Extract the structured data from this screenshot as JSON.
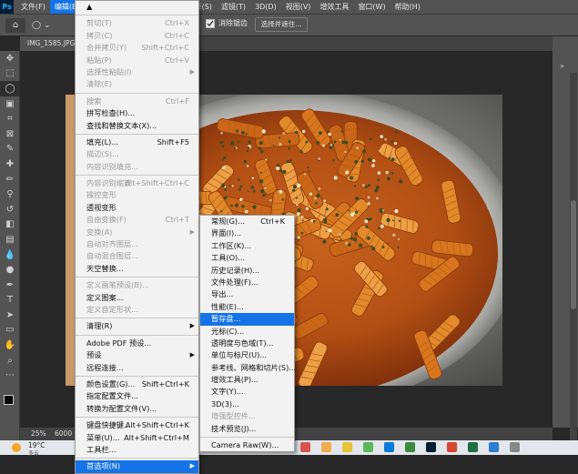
{
  "menubar": {
    "logo": "Ps",
    "items": [
      "文件(F)",
      "编辑(E)",
      "图像(I)",
      "图层(L)",
      "文字(Y)",
      "选择(S)",
      "滤镜(T)",
      "3D(D)",
      "视图(V)",
      "增效工具",
      "窗口(W)",
      "帮助(H)"
    ]
  },
  "optionsbar": {
    "antialias_label": "消除锯齿",
    "select_subject_label": "选择并遮住..."
  },
  "doc_tab": {
    "title": "IMG_1585.JPG"
  },
  "status": {
    "zoom": "25%",
    "info": "6000"
  },
  "taskbar": {
    "weather": "19°C",
    "weather_sub": "多云"
  },
  "edit_menu": {
    "items": [
      {
        "type": "item",
        "label": "▲",
        "shortcut": "",
        "disabled": false,
        "submenu": false
      },
      {
        "type": "sep"
      },
      {
        "type": "item",
        "label": "剪切(T)",
        "shortcut": "Ctrl+X",
        "disabled": true,
        "submenu": false
      },
      {
        "type": "item",
        "label": "拷贝(C)",
        "shortcut": "Ctrl+C",
        "disabled": true,
        "submenu": false
      },
      {
        "type": "item",
        "label": "合并拷贝(Y)",
        "shortcut": "Shift+Ctrl+C",
        "disabled": true,
        "submenu": false
      },
      {
        "type": "item",
        "label": "粘贴(P)",
        "shortcut": "Ctrl+V",
        "disabled": true,
        "submenu": false
      },
      {
        "type": "item",
        "label": "选择性粘贴(I)",
        "shortcut": "",
        "disabled": true,
        "submenu": true
      },
      {
        "type": "item",
        "label": "清除(E)",
        "shortcut": "",
        "disabled": true,
        "submenu": false
      },
      {
        "type": "sep"
      },
      {
        "type": "item",
        "label": "搜索",
        "shortcut": "Ctrl+F",
        "disabled": true,
        "submenu": false
      },
      {
        "type": "item",
        "label": "拼写检查(H)...",
        "shortcut": "",
        "disabled": false,
        "submenu": false
      },
      {
        "type": "item",
        "label": "查找和替换文本(X)...",
        "shortcut": "",
        "disabled": false,
        "submenu": false
      },
      {
        "type": "sep"
      },
      {
        "type": "item",
        "label": "填充(L)...",
        "shortcut": "Shift+F5",
        "disabled": false,
        "submenu": false
      },
      {
        "type": "item",
        "label": "描边(S)...",
        "shortcut": "",
        "disabled": true,
        "submenu": false
      },
      {
        "type": "item",
        "label": "内容识别填充...",
        "shortcut": "",
        "disabled": true,
        "submenu": false
      },
      {
        "type": "sep"
      },
      {
        "type": "item",
        "label": "内容识别缩放",
        "shortcut": "Alt+Shift+Ctrl+C",
        "disabled": true,
        "submenu": false
      },
      {
        "type": "item",
        "label": "操控变形",
        "shortcut": "",
        "disabled": true,
        "submenu": false
      },
      {
        "type": "item",
        "label": "透视变形",
        "shortcut": "",
        "disabled": false,
        "submenu": false
      },
      {
        "type": "item",
        "label": "自由变换(F)",
        "shortcut": "Ctrl+T",
        "disabled": true,
        "submenu": false
      },
      {
        "type": "item",
        "label": "变换(A)",
        "shortcut": "",
        "disabled": true,
        "submenu": true
      },
      {
        "type": "item",
        "label": "自动对齐图层...",
        "shortcut": "",
        "disabled": true,
        "submenu": false
      },
      {
        "type": "item",
        "label": "自动混合图层...",
        "shortcut": "",
        "disabled": true,
        "submenu": false
      },
      {
        "type": "item",
        "label": "天空替换...",
        "shortcut": "",
        "disabled": false,
        "submenu": false
      },
      {
        "type": "sep"
      },
      {
        "type": "item",
        "label": "定义画笔预设(B)...",
        "shortcut": "",
        "disabled": true,
        "submenu": false
      },
      {
        "type": "item",
        "label": "定义图案...",
        "shortcut": "",
        "disabled": false,
        "submenu": false
      },
      {
        "type": "item",
        "label": "定义自定形状...",
        "shortcut": "",
        "disabled": true,
        "submenu": false
      },
      {
        "type": "sep"
      },
      {
        "type": "item",
        "label": "清理(R)",
        "shortcut": "",
        "disabled": false,
        "submenu": true
      },
      {
        "type": "sep"
      },
      {
        "type": "item",
        "label": "Adobe PDF 预设...",
        "shortcut": "",
        "disabled": false,
        "submenu": false
      },
      {
        "type": "item",
        "label": "预设",
        "shortcut": "",
        "disabled": false,
        "submenu": true
      },
      {
        "type": "item",
        "label": "远程连接...",
        "shortcut": "",
        "disabled": false,
        "submenu": false
      },
      {
        "type": "sep"
      },
      {
        "type": "item",
        "label": "颜色设置(G)...",
        "shortcut": "Shift+Ctrl+K",
        "disabled": false,
        "submenu": false
      },
      {
        "type": "item",
        "label": "指定配置文件...",
        "shortcut": "",
        "disabled": false,
        "submenu": false
      },
      {
        "type": "item",
        "label": "转换为配置文件(V)...",
        "shortcut": "",
        "disabled": false,
        "submenu": false
      },
      {
        "type": "sep"
      },
      {
        "type": "item",
        "label": "键盘快捷键...",
        "shortcut": "Alt+Shift+Ctrl+K",
        "disabled": false,
        "submenu": false
      },
      {
        "type": "item",
        "label": "菜单(U)...",
        "shortcut": "Alt+Shift+Ctrl+M",
        "disabled": false,
        "submenu": false
      },
      {
        "type": "item",
        "label": "工具栏...",
        "shortcut": "",
        "disabled": false,
        "submenu": false
      },
      {
        "type": "sep"
      },
      {
        "type": "item",
        "label": "首选项(N)",
        "shortcut": "",
        "disabled": false,
        "submenu": true,
        "highlight": true
      }
    ]
  },
  "pref_menu": {
    "items": [
      {
        "type": "item",
        "label": "常规(G)...",
        "shortcut": "Ctrl+K",
        "disabled": false
      },
      {
        "type": "item",
        "label": "界面(I)...",
        "shortcut": "",
        "disabled": false
      },
      {
        "type": "item",
        "label": "工作区(K)...",
        "shortcut": "",
        "disabled": false
      },
      {
        "type": "item",
        "label": "工具(O)...",
        "shortcut": "",
        "disabled": false
      },
      {
        "type": "item",
        "label": "历史记录(H)...",
        "shortcut": "",
        "disabled": false
      },
      {
        "type": "item",
        "label": "文件处理(F)...",
        "shortcut": "",
        "disabled": false
      },
      {
        "type": "item",
        "label": "导出...",
        "shortcut": "",
        "disabled": false
      },
      {
        "type": "item",
        "label": "性能(E)...",
        "shortcut": "",
        "disabled": false
      },
      {
        "type": "item",
        "label": "暂存盘...",
        "shortcut": "",
        "disabled": false,
        "highlight": true
      },
      {
        "type": "item",
        "label": "光标(C)...",
        "shortcut": "",
        "disabled": false
      },
      {
        "type": "item",
        "label": "透明度与色域(T)...",
        "shortcut": "",
        "disabled": false
      },
      {
        "type": "item",
        "label": "单位与标尺(U)...",
        "shortcut": "",
        "disabled": false
      },
      {
        "type": "item",
        "label": "参考线、网格和切片(S)...",
        "shortcut": "",
        "disabled": false
      },
      {
        "type": "item",
        "label": "增效工具(P)...",
        "shortcut": "",
        "disabled": false
      },
      {
        "type": "item",
        "label": "文字(Y)...",
        "shortcut": "",
        "disabled": false
      },
      {
        "type": "item",
        "label": "3D(3)...",
        "shortcut": "",
        "disabled": false
      },
      {
        "type": "item",
        "label": "增强型控件...",
        "shortcut": "",
        "disabled": true
      },
      {
        "type": "item",
        "label": "技术预览(J)...",
        "shortcut": "",
        "disabled": false
      },
      {
        "type": "sep"
      },
      {
        "type": "item",
        "label": "Camera Raw(W)...",
        "shortcut": "",
        "disabled": false
      }
    ]
  },
  "icons": {
    "tools": [
      "move-icon",
      "marquee-icon",
      "lasso-icon",
      "object-select-icon",
      "crop-icon",
      "frame-icon",
      "eyedropper-icon",
      "healing-brush-icon",
      "brush-icon",
      "clone-stamp-icon",
      "history-brush-icon",
      "eraser-icon",
      "gradient-icon",
      "blur-icon",
      "dodge-icon",
      "pen-icon",
      "type-icon",
      "path-select-icon",
      "rectangle-icon",
      "hand-icon",
      "zoom-icon",
      "more-tools-icon"
    ]
  },
  "colors": {
    "ps_bg": "#535353",
    "accent": "#1473e6",
    "canvas_bg": "#282828"
  }
}
